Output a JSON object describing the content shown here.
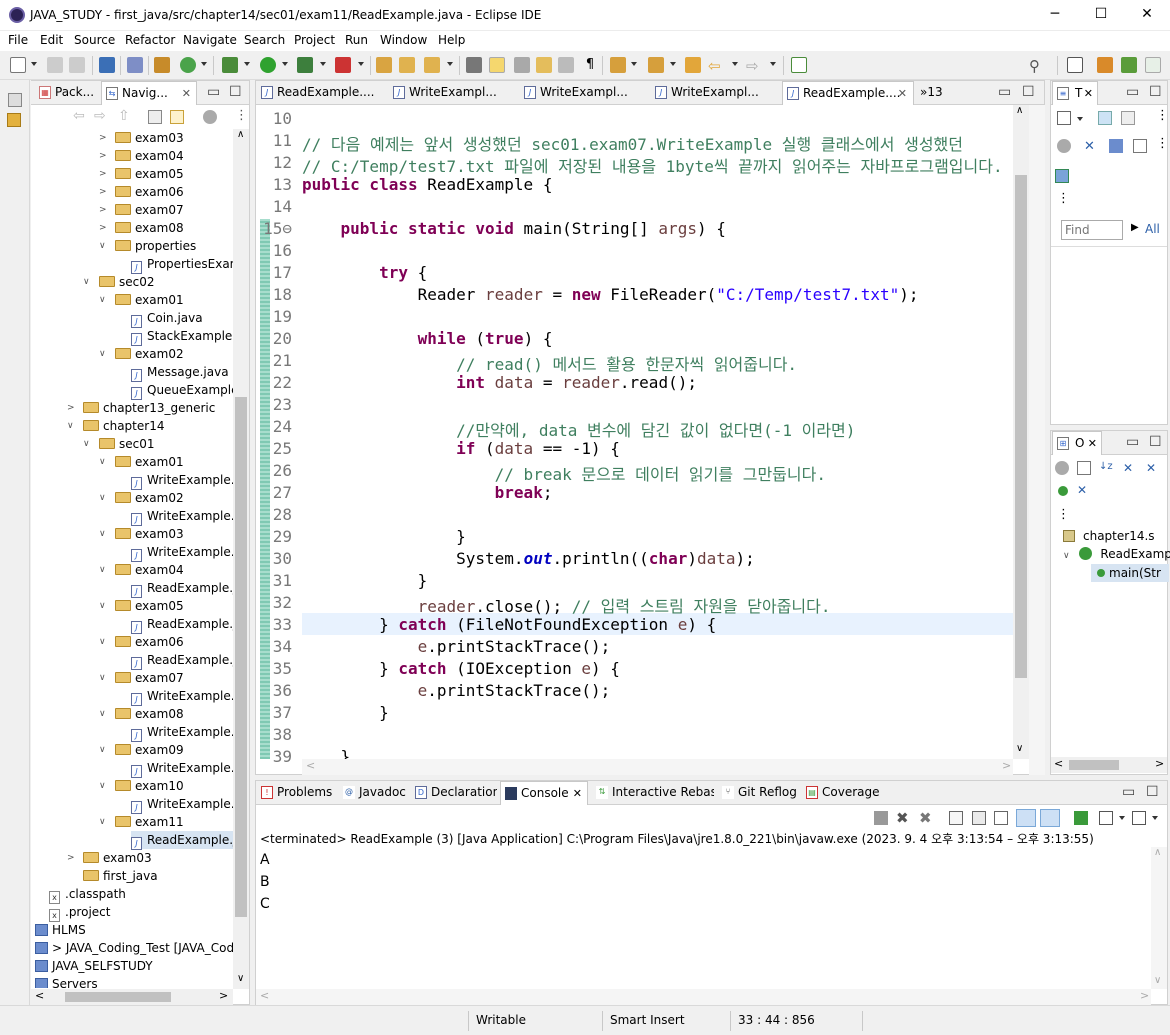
{
  "window": {
    "title": "JAVA_STUDY - first_java/src/chapter14/sec01/exam11/ReadExample.java - Eclipse IDE",
    "minimize": "─",
    "maximize": "☐",
    "close": "✕"
  },
  "menu": [
    "File",
    "Edit",
    "Source",
    "Refactor",
    "Navigate",
    "Search",
    "Project",
    "Run",
    "Window",
    "Help"
  ],
  "left_tabs": {
    "packages": "Pack...",
    "navigator": "Navig..."
  },
  "tree": [
    {
      "label": "exam03",
      "type": "folder",
      "indent": 3,
      "open": false
    },
    {
      "label": "exam04",
      "type": "folder",
      "indent": 3,
      "open": false
    },
    {
      "label": "exam05",
      "type": "folder",
      "indent": 3,
      "open": false
    },
    {
      "label": "exam06",
      "type": "folder",
      "indent": 3,
      "open": false
    },
    {
      "label": "exam07",
      "type": "folder",
      "indent": 3,
      "open": false
    },
    {
      "label": "exam08",
      "type": "folder",
      "indent": 3,
      "open": false
    },
    {
      "label": "properties",
      "type": "folder",
      "indent": 3,
      "open": true
    },
    {
      "label": "PropertiesExample.",
      "type": "file",
      "indent": 4
    },
    {
      "label": "sec02",
      "type": "folder",
      "indent": 2,
      "open": true
    },
    {
      "label": "exam01",
      "type": "folder",
      "indent": 3,
      "open": true
    },
    {
      "label": "Coin.java",
      "type": "file",
      "indent": 4
    },
    {
      "label": "StackExample.java",
      "type": "file",
      "indent": 4
    },
    {
      "label": "exam02",
      "type": "folder",
      "indent": 3,
      "open": true
    },
    {
      "label": "Message.java",
      "type": "file",
      "indent": 4
    },
    {
      "label": "QueueExample.java",
      "type": "file",
      "indent": 4
    },
    {
      "label": "chapter13_generic",
      "type": "folder",
      "indent": 1,
      "open": false
    },
    {
      "label": "chapter14",
      "type": "folder",
      "indent": 1,
      "open": true
    },
    {
      "label": "sec01",
      "type": "folder",
      "indent": 2,
      "open": true
    },
    {
      "label": "exam01",
      "type": "folder",
      "indent": 3,
      "open": true
    },
    {
      "label": "WriteExample.java",
      "type": "file",
      "indent": 4
    },
    {
      "label": "exam02",
      "type": "folder",
      "indent": 3,
      "open": true
    },
    {
      "label": "WriteExample.java",
      "type": "file",
      "indent": 4
    },
    {
      "label": "exam03",
      "type": "folder",
      "indent": 3,
      "open": true
    },
    {
      "label": "WriteExample.java",
      "type": "file",
      "indent": 4
    },
    {
      "label": "exam04",
      "type": "folder",
      "indent": 3,
      "open": true
    },
    {
      "label": "ReadExample.java",
      "type": "file",
      "indent": 4
    },
    {
      "label": "exam05",
      "type": "folder",
      "indent": 3,
      "open": true
    },
    {
      "label": "ReadExample.java",
      "type": "file",
      "indent": 4
    },
    {
      "label": "exam06",
      "type": "folder",
      "indent": 3,
      "open": true
    },
    {
      "label": "ReadExample.java",
      "type": "file",
      "indent": 4
    },
    {
      "label": "exam07",
      "type": "folder",
      "indent": 3,
      "open": true
    },
    {
      "label": "WriteExample.java",
      "type": "file",
      "indent": 4
    },
    {
      "label": "exam08",
      "type": "folder",
      "indent": 3,
      "open": true
    },
    {
      "label": "WriteExample.java",
      "type": "file",
      "indent": 4
    },
    {
      "label": "exam09",
      "type": "folder",
      "indent": 3,
      "open": true
    },
    {
      "label": "WriteExample.java",
      "type": "file",
      "indent": 4
    },
    {
      "label": "exam10",
      "type": "folder",
      "indent": 3,
      "open": true
    },
    {
      "label": "WriteExample.java",
      "type": "file",
      "indent": 4
    },
    {
      "label": "exam11",
      "type": "folder",
      "indent": 3,
      "open": true
    },
    {
      "label": "ReadExample.java",
      "type": "file",
      "indent": 4,
      "selected": true
    },
    {
      "label": "exam03",
      "type": "folder",
      "indent": 1,
      "open": false
    },
    {
      "label": "first_java",
      "type": "folder",
      "indent": 1,
      "open": null
    },
    {
      "label": ".classpath",
      "type": "xml",
      "indent": 0
    },
    {
      "label": ".project",
      "type": "xml",
      "indent": 0
    },
    {
      "label": "HLMS",
      "type": "project",
      "indent": -1
    },
    {
      "label": "> JAVA_Coding_Test [JAVA_Codir",
      "type": "project",
      "indent": -1
    },
    {
      "label": "JAVA_SELFSTUDY",
      "type": "project",
      "indent": -1
    },
    {
      "label": "Servers",
      "type": "project",
      "indent": -1
    }
  ],
  "editor_tabs": [
    {
      "label": "ReadExample...."
    },
    {
      "label": "WriteExampl..."
    },
    {
      "label": "WriteExampl..."
    },
    {
      "label": "WriteExampl..."
    },
    {
      "label": "ReadExample....",
      "active": true
    }
  ],
  "editor_overflow": "»13",
  "code_lines": [
    {
      "n": "10",
      "html": ""
    },
    {
      "n": "11",
      "html": "<span class='cm'>// 다음 예제는 앞서 생성했던 sec01.exam07.WriteExample 실행 클래스에서 생성했던</span>"
    },
    {
      "n": "12",
      "html": "<span class='cm'>// C:/Temp/test7.txt 파일에 저장된 내용을 1byte씩 끝까지 읽어주는 자바프로그램입니다.</span>"
    },
    {
      "n": "13",
      "html": "<span class='kw'>public class</span> ReadExample {"
    },
    {
      "n": "14",
      "html": ""
    },
    {
      "n": "15⊖",
      "html": "    <span class='kw'>public static void</span> main(String[] <span class='var'>args</span>) {"
    },
    {
      "n": "16",
      "html": ""
    },
    {
      "n": "17",
      "html": "        <span class='kw'>try</span> {"
    },
    {
      "n": "18",
      "html": "            Reader <span class='var'>reader</span> = <span class='kw'>new</span> FileReader(<span class='str'>\"C:/Temp/test7.txt\"</span>);"
    },
    {
      "n": "19",
      "html": ""
    },
    {
      "n": "20",
      "html": "            <span class='kw'>while</span> (<span class='kw'>true</span>) {"
    },
    {
      "n": "21",
      "html": "                <span class='cm'>// read() 메서드 활용 한문자씩 읽어줍니다.</span>"
    },
    {
      "n": "22",
      "html": "                <span class='kw'>int</span> <span class='var'>data</span> = <span class='var'>reader</span>.read();"
    },
    {
      "n": "23",
      "html": ""
    },
    {
      "n": "24",
      "html": "                <span class='cm'>//만약에, data 변수에 담긴 값이 없다면(-1 이라면)</span>"
    },
    {
      "n": "25",
      "html": "                <span class='kw'>if</span> (<span class='var'>data</span> == -1) {"
    },
    {
      "n": "26",
      "html": "                    <span class='cm'>// break 문으로 데이터 읽기를 그만둡니다.</span>"
    },
    {
      "n": "27",
      "html": "                    <span class='kw'>break</span>;"
    },
    {
      "n": "28",
      "html": ""
    },
    {
      "n": "29",
      "html": "                }"
    },
    {
      "n": "30",
      "html": "                System.<span class='fld'>out</span>.println((<span class='kw'>char</span>)<span class='var'>data</span>);"
    },
    {
      "n": "31",
      "html": "            }"
    },
    {
      "n": "32",
      "html": "            <span class='var'>reader</span>.close(); <span class='cm'>// 입력 스트림 자원을 닫아줍니다.</span>"
    },
    {
      "n": "33",
      "html": "        } <span class='kw'>catch</span> (FileNotFoundException <span class='var'>e</span>) {"
    },
    {
      "n": "34",
      "html": "            <span class='var'>e</span>.printStackTrace();"
    },
    {
      "n": "35",
      "html": "        } <span class='kw'>catch</span> (IOException <span class='var'>e</span>) {"
    },
    {
      "n": "36",
      "html": "            <span class='var'>e</span>.printStackTrace();"
    },
    {
      "n": "37",
      "html": "        }"
    },
    {
      "n": "38",
      "html": ""
    },
    {
      "n": "39",
      "html": "    }"
    }
  ],
  "right_top": {
    "tab": "T",
    "find_placeholder": "Find",
    "all": "All"
  },
  "outline": {
    "tab": "O",
    "items": [
      "chapter14.s",
      "ReadExamp",
      "main(Str"
    ]
  },
  "bottom_tabs": [
    "Problems",
    "Javadoc",
    "Declaration",
    "Console",
    "Interactive Rebase",
    "Git Reflog",
    "Coverage"
  ],
  "console": {
    "header": "<terminated> ReadExample (3) [Java Application] C:\\Program Files\\Java\\jre1.8.0_221\\bin\\javaw.exe  (2023. 9. 4 오후 3:13:54 – 오후 3:13:55)",
    "output": [
      "A",
      "B",
      "C"
    ]
  },
  "status": {
    "writable": "Writable",
    "insert": "Smart Insert",
    "position": "33 : 44 : 856"
  },
  "colors": {
    "keyword": "#7f0055",
    "comment": "#3f7f5f",
    "string": "#2a00ff",
    "current_line": "#e8f2fe"
  }
}
